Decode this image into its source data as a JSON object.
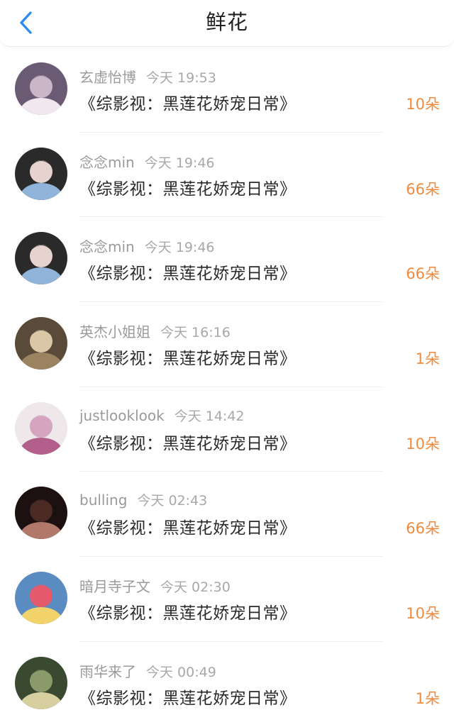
{
  "header": {
    "title": "鲜花",
    "back_icon": "chevron-left-icon",
    "accent": "#2f8df0"
  },
  "colors": {
    "count": "#f08a3c",
    "name": "#9a9a9a",
    "text": "#2a2a2a"
  },
  "items": [
    {
      "name": "玄虚怡博",
      "time": "今天 19:53",
      "book": "《综影视：黑莲花娇宠日常》",
      "count": "10朵",
      "avatar_colors": [
        "#6b5a73",
        "#c9b7c9",
        "#f0e8ee"
      ]
    },
    {
      "name": "念念min",
      "time": "今天 19:46",
      "book": "《综影视：黑莲花娇宠日常》",
      "count": "66朵",
      "avatar_colors": [
        "#2a2a2a",
        "#e6d3cd",
        "#8fb3d9"
      ]
    },
    {
      "name": "念念min",
      "time": "今天 19:46",
      "book": "《综影视：黑莲花娇宠日常》",
      "count": "66朵",
      "avatar_colors": [
        "#2a2a2a",
        "#e6d3cd",
        "#8fb3d9"
      ]
    },
    {
      "name": "英杰小姐姐",
      "time": "今天 16:16",
      "book": "《综影视：黑莲花娇宠日常》",
      "count": "1朵",
      "avatar_colors": [
        "#5a4a3a",
        "#d9c7a6",
        "#9b8260"
      ]
    },
    {
      "name": "justlooklook",
      "time": "今天 14:42",
      "book": "《综影视：黑莲花娇宠日常》",
      "count": "10朵",
      "avatar_colors": [
        "#efe8ea",
        "#d4a4c0",
        "#b35f8c"
      ]
    },
    {
      "name": "bulling",
      "time": "今天 02:43",
      "book": "《综影视：黑莲花娇宠日常》",
      "count": "66朵",
      "avatar_colors": [
        "#1c1010",
        "#4a2a22",
        "#b0796a"
      ]
    },
    {
      "name": "暗月寺子文",
      "time": "今天 02:30",
      "book": "《综影视：黑莲花娇宠日常》",
      "count": "10朵",
      "avatar_colors": [
        "#5a8cc2",
        "#e45a6c",
        "#f2d36b"
      ]
    },
    {
      "name": "雨华来了",
      "time": "今天 00:49",
      "book": "《综影视：黑莲花娇宠日常》",
      "count": "1朵",
      "avatar_colors": [
        "#3a4a30",
        "#8a9a6a",
        "#d7cfa0"
      ]
    }
  ]
}
